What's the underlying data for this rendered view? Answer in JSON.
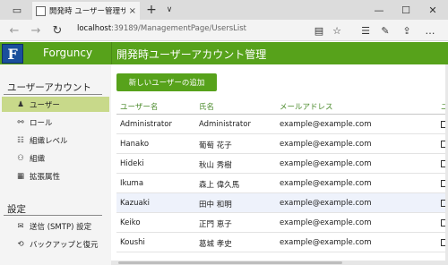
{
  "browser": {
    "tab_title": "開発時 ユーザー管理サービ",
    "tab_close": "×",
    "new_tab": "+",
    "tab_menu": "∨",
    "url_host": "localhost",
    "url_path": ":39189/ManagementPage/UsersList",
    "win_min": "—",
    "win_max": "☐",
    "win_close": "✕"
  },
  "header": {
    "brand": "Forguncy",
    "page_title": "開発時ユーザーアカウント管理",
    "logo_letter": "F",
    "color": "#57a21b"
  },
  "sidebar": {
    "section_accounts": "ユーザーアカウント",
    "section_settings": "設定",
    "items": [
      {
        "label": "ユーザー",
        "icon": "user-icon"
      },
      {
        "label": "ロール",
        "icon": "role-icon"
      },
      {
        "label": "組織レベル",
        "icon": "org-level-icon"
      },
      {
        "label": "組織",
        "icon": "org-icon"
      },
      {
        "label": "拡張属性",
        "icon": "extension-icon"
      }
    ],
    "settings_items": [
      {
        "label": "送信 (SMTP) 設定",
        "icon": "mail-icon"
      },
      {
        "label": "バックアップと復元",
        "icon": "backup-icon"
      }
    ]
  },
  "main": {
    "add_button": "新しいユーザーの追加",
    "columns": [
      "ユーザー名",
      "氏名",
      "メールアドレス",
      "ユ"
    ],
    "rows": [
      {
        "username": "Administrator",
        "fullname": "Administrator",
        "email": "example@example.com"
      },
      {
        "username": "Hanako",
        "fullname": "葡萄 花子",
        "email": "example@example.com"
      },
      {
        "username": "Hideki",
        "fullname": "秋山 秀樹",
        "email": "example@example.com"
      },
      {
        "username": "Ikuma",
        "fullname": "森上 偉久馬",
        "email": "example@example.com"
      },
      {
        "username": "Kazuaki",
        "fullname": "田中 和明",
        "email": "example@example.com"
      },
      {
        "username": "Keiko",
        "fullname": "正門 恵子",
        "email": "example@example.com"
      },
      {
        "username": "Koushi",
        "fullname": "葛城 孝史",
        "email": "example@example.com"
      }
    ]
  }
}
